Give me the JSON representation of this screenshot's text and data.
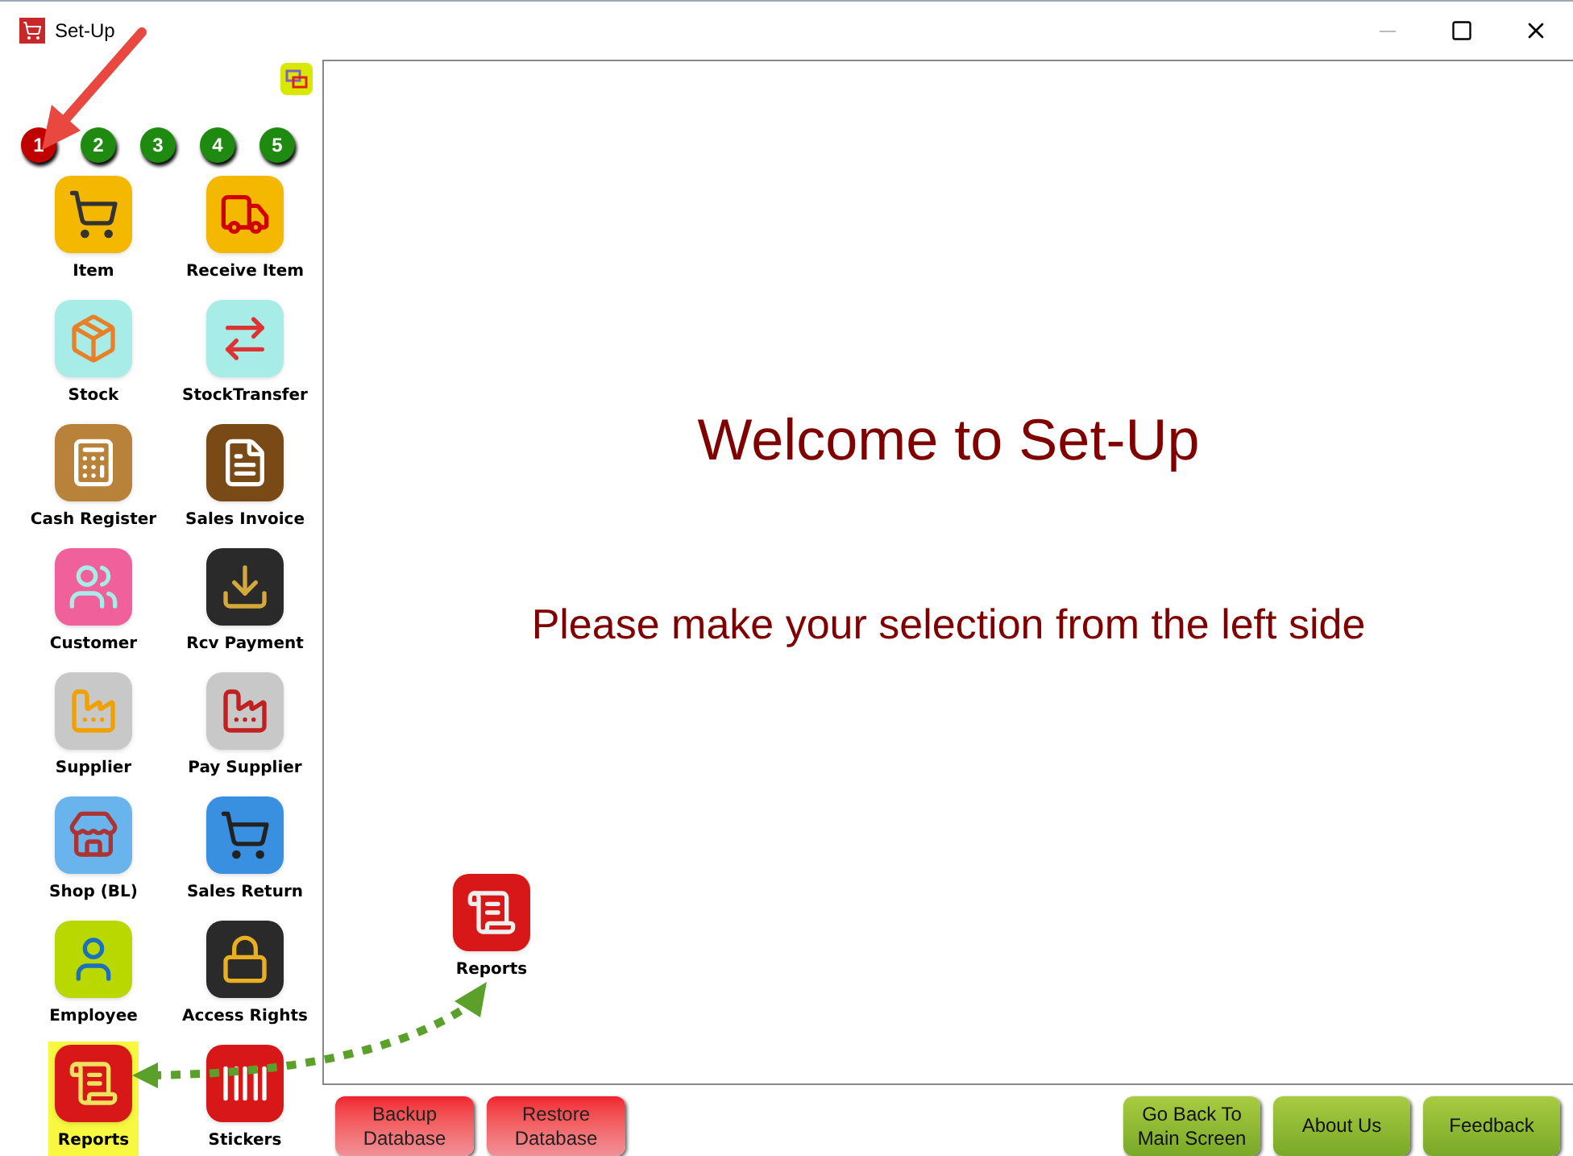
{
  "window": {
    "title": "Set-Up"
  },
  "pages": [
    {
      "label": "1",
      "selected": true
    },
    {
      "label": "2",
      "selected": false
    },
    {
      "label": "3",
      "selected": false
    },
    {
      "label": "4",
      "selected": false
    },
    {
      "label": "5",
      "selected": false
    }
  ],
  "modules": [
    {
      "label": "Item",
      "highlighted": false
    },
    {
      "label": "Receive Item",
      "highlighted": false
    },
    {
      "label": "Stock",
      "highlighted": false
    },
    {
      "label": "StockTransfer",
      "highlighted": false
    },
    {
      "label": "Cash Register",
      "highlighted": false
    },
    {
      "label": "Sales Invoice",
      "highlighted": false
    },
    {
      "label": "Customer",
      "highlighted": false
    },
    {
      "label": "Rcv Payment",
      "highlighted": false
    },
    {
      "label": "Supplier",
      "highlighted": false
    },
    {
      "label": "Pay Supplier",
      "highlighted": false
    },
    {
      "label": "Shop (BL)",
      "highlighted": false
    },
    {
      "label": "Sales Return",
      "highlighted": false
    },
    {
      "label": "Employee",
      "highlighted": false
    },
    {
      "label": "Access Rights",
      "highlighted": false
    },
    {
      "label": "Reports",
      "highlighted": true
    },
    {
      "label": "Stickers",
      "highlighted": false
    }
  ],
  "main": {
    "heading": "Welcome to Set-Up",
    "subheading": "Please make your selection from the left side",
    "floating_item": {
      "label": "Reports"
    }
  },
  "footer_left": [
    {
      "label": "Backup Database"
    },
    {
      "label": "Restore Database"
    }
  ],
  "footer_right": [
    {
      "label": "Go Back To Main Screen"
    },
    {
      "label": "About Us"
    },
    {
      "label": "Feedback"
    }
  ]
}
